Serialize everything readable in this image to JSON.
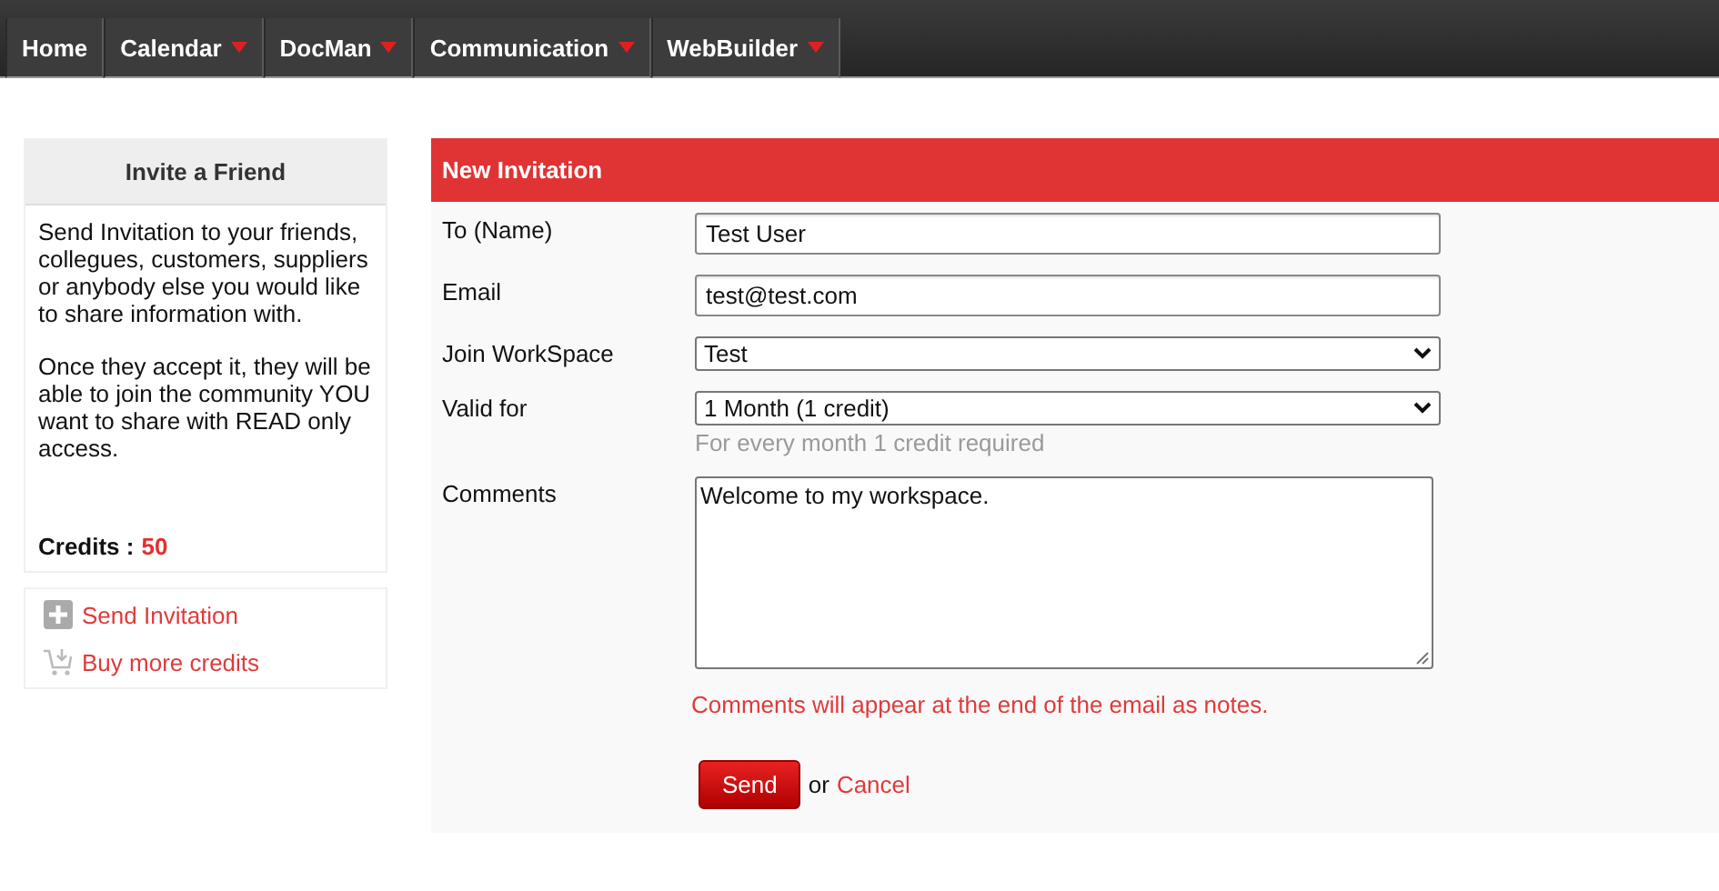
{
  "nav": [
    {
      "label": "Home",
      "has_menu": false
    },
    {
      "label": "Calendar",
      "has_menu": true
    },
    {
      "label": "DocMan",
      "has_menu": true
    },
    {
      "label": "Communication",
      "has_menu": true
    },
    {
      "label": "WebBuilder",
      "has_menu": true
    }
  ],
  "sidebar": {
    "title": "Invite a Friend",
    "paragraphs": [
      "Send Invitation to your friends, collegues, customers, suppliers or anybody else you would like to share information with.",
      "Once they accept it, they will be able to join the community YOU want to share with READ only access."
    ],
    "credits_label": "Credits :",
    "credits_value": "50",
    "links": [
      {
        "kind": "add",
        "label": "Send Invitation"
      },
      {
        "kind": "cart",
        "label": "Buy more credits"
      }
    ]
  },
  "form": {
    "title": "New Invitation",
    "fields": [
      {
        "kind": "text",
        "label": "To (Name)",
        "value": "Test User"
      },
      {
        "kind": "text",
        "label": "Email",
        "value": "test@test.com"
      },
      {
        "kind": "select",
        "label": "Join WorkSpace",
        "value": "Test"
      },
      {
        "kind": "select",
        "label": "Valid for",
        "value": "1 Month (1 credit)",
        "hint": "For every month 1 credit required"
      },
      {
        "kind": "textarea",
        "label": "Comments",
        "value": "Welcome to my workspace.",
        "note": "Comments will appear at the end of the email as notes."
      }
    ],
    "submit": "Send",
    "or_text": "or",
    "cancel": "Cancel"
  }
}
